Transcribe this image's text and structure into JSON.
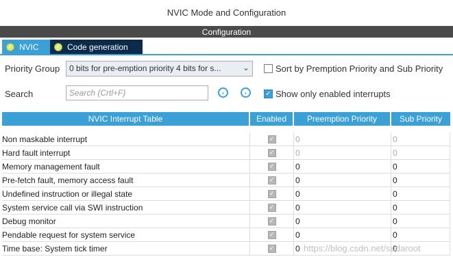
{
  "window": {
    "title": "NVIC Mode and Configuration"
  },
  "config_bar": {
    "label": "Configuration"
  },
  "tabs": [
    {
      "label": "NVIC",
      "active": true
    },
    {
      "label": "Code generation",
      "active": false
    }
  ],
  "priority_group": {
    "label": "Priority Group",
    "value": "0 bits for pre-emption priority 4 bits for s..."
  },
  "sort_option": {
    "label": "Sort by Premption Priority and Sub Priority",
    "checked": false
  },
  "search": {
    "label": "Search",
    "placeholder": "Search (Crtl+F)"
  },
  "show_enabled": {
    "label": "Show only enabled interrupts",
    "checked": true
  },
  "table": {
    "headers": [
      "NVIC Interrupt Table",
      "Enabled",
      "Preemption Priority",
      "Sub Priority"
    ],
    "rows": [
      {
        "name": "Non maskable interrupt",
        "enabled": true,
        "preemption": "0",
        "sub": "0",
        "editable": false
      },
      {
        "name": "Hard fault interrupt",
        "enabled": true,
        "preemption": "0",
        "sub": "0",
        "editable": false
      },
      {
        "name": "Memory management fault",
        "enabled": true,
        "preemption": "0",
        "sub": "0",
        "editable": true
      },
      {
        "name": "Pre-fetch fault, memory access fault",
        "enabled": true,
        "preemption": "0",
        "sub": "0",
        "editable": true
      },
      {
        "name": "Undefined instruction or illegal state",
        "enabled": true,
        "preemption": "0",
        "sub": "0",
        "editable": true
      },
      {
        "name": "System service call via SWI instruction",
        "enabled": true,
        "preemption": "0",
        "sub": "0",
        "editable": true
      },
      {
        "name": "Debug monitor",
        "enabled": true,
        "preemption": "0",
        "sub": "0",
        "editable": true
      },
      {
        "name": "Pendable request for system service",
        "enabled": true,
        "preemption": "0",
        "sub": "0",
        "editable": true
      },
      {
        "name": "Time base: System tick timer",
        "enabled": true,
        "preemption": "0",
        "sub": "0",
        "editable": true
      }
    ]
  },
  "watermark": "https://blog.csdn.net/sudaroot",
  "colors": {
    "accent": "#3aa0d5",
    "tab_dark": "#0b2a4c",
    "config_bar": "#4a4a4a"
  }
}
